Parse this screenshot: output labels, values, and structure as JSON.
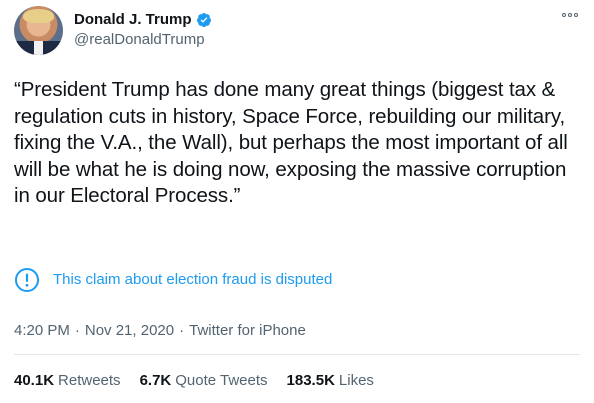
{
  "author": {
    "name": "Donald J. Trump",
    "handle": "@realDonaldTrump"
  },
  "tweet": {
    "text": "“President Trump has done many great things (biggest tax & regulation cuts in history, Space Force, rebuilding our military, fixing the V.A., the Wall), but perhaps the most important of all will be what he is doing now, exposing the massive corruption in our Electoral Process.”"
  },
  "notice": {
    "text": "This claim about election fraud is disputed"
  },
  "meta": {
    "time": "4:20 PM",
    "date": "Nov 21, 2020",
    "source": "Twitter for iPhone",
    "separator": "·"
  },
  "stats": {
    "retweets_count": "40.1K",
    "retweets_label": "Retweets",
    "quote_tweets_count": "6.7K",
    "quote_tweets_label": "Quote Tweets",
    "likes_count": "183.5K",
    "likes_label": "Likes"
  },
  "colors": {
    "accent": "#1d9bf0",
    "secondary_text": "#536471",
    "primary_text": "#0f1419"
  },
  "icons": {
    "verified": "verified-badge-icon",
    "more": "more-options-icon",
    "notice": "exclamation-circle-icon"
  }
}
